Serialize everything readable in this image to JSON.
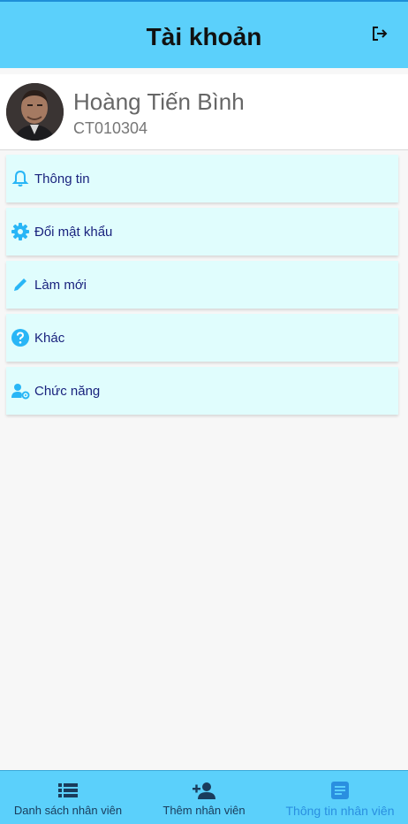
{
  "header": {
    "title": "Tài khoản",
    "logout_icon": "logout-icon"
  },
  "profile": {
    "name": "Hoàng Tiến Bình",
    "code": "CT010304"
  },
  "menu": [
    {
      "label": "Thông tin",
      "icon": "bell-icon"
    },
    {
      "label": "Đổi mật khẩu",
      "icon": "gear-icon"
    },
    {
      "label": "Làm mới",
      "icon": "pencil-icon"
    },
    {
      "label": "Khác",
      "icon": "help-circle-icon"
    },
    {
      "label": "Chức năng",
      "icon": "user-settings-icon"
    }
  ],
  "bottom_nav": [
    {
      "label": "Danh sách nhân viên",
      "icon": "list-icon",
      "active": false
    },
    {
      "label": "Thêm nhân viên",
      "icon": "add-user-icon",
      "active": false
    },
    {
      "label": "Thông tin nhân viên",
      "icon": "document-icon",
      "active": true
    }
  ],
  "colors": {
    "header_bg": "#5bd0fb",
    "menu_bg": "#e0fdfd",
    "menu_text": "#1a237e",
    "icon_accent": "#29b6f6",
    "active_tab": "#2a8fe0"
  }
}
